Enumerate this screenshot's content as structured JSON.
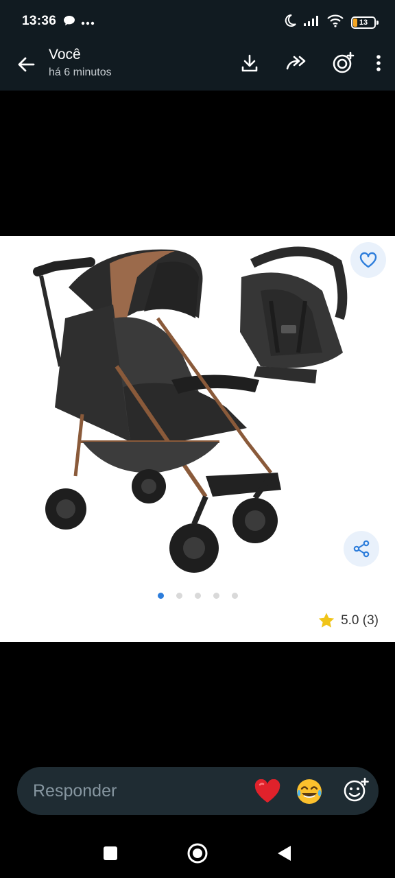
{
  "status_bar": {
    "time": "13:36",
    "battery": "13",
    "icons": [
      "chat-bubble-icon",
      "more-notifications-icon",
      "moon-icon",
      "signal-icon",
      "wifi-icon",
      "battery-icon"
    ]
  },
  "header": {
    "title": "Você",
    "subtitle": "há 6 minutos",
    "actions": [
      "download-icon",
      "forward-icon",
      "add-status-icon",
      "more-vert-icon"
    ]
  },
  "media": {
    "subject": "stroller-with-car-seat",
    "accent_color": "#2d7ddb",
    "rating": "5.0 (3)",
    "carousel_total": 5,
    "carousel_active": 1
  },
  "reply": {
    "placeholder": "Responder",
    "quick_reactions": [
      "red-heart-emoji",
      "tears-of-joy-emoji"
    ]
  },
  "colors": {
    "bar_bg": "#111b21",
    "reply_bg": "#1f2c33",
    "placeholder": "#8696a0",
    "star": "#f0c419"
  }
}
